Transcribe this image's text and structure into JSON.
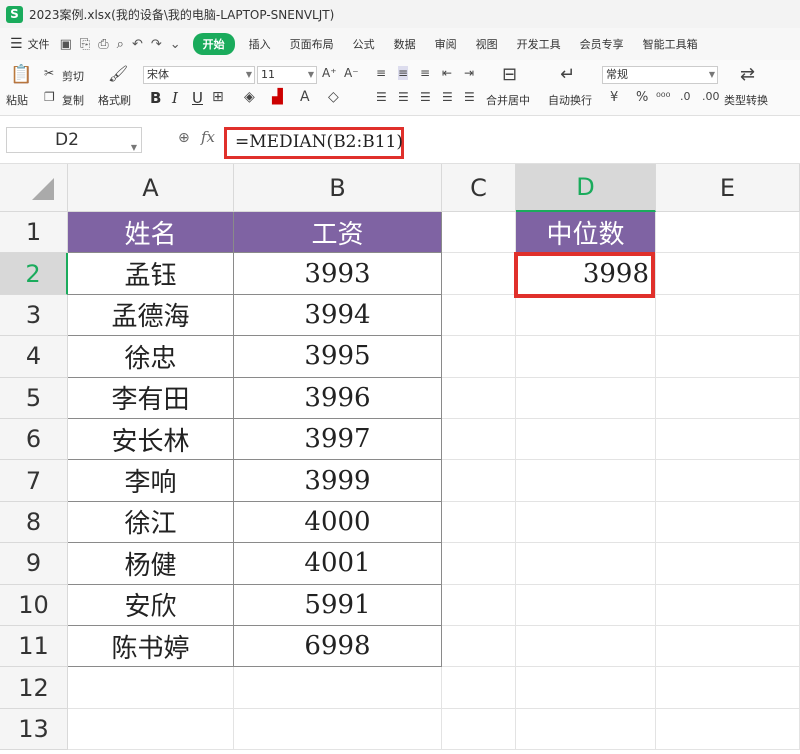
{
  "window": {
    "title": "2023案例.xlsx(我的设备\\我的电脑-LAPTOP-SNENVLJT)",
    "app_icon": "S"
  },
  "menubar": {
    "file": "文件",
    "tabs": [
      "开始",
      "插入",
      "页面布局",
      "公式",
      "数据",
      "审阅",
      "视图",
      "开发工具",
      "会员专享",
      "智能工具箱"
    ]
  },
  "ribbon": {
    "paste": "粘贴",
    "cut": "剪切",
    "copy": "复制",
    "format_painter": "格式刷",
    "font_name": "宋体",
    "font_size": "11",
    "bold": "B",
    "italic": "I",
    "underline": "U",
    "merge_center": "合并居中",
    "wrap_text": "自动换行",
    "number_format": "常规",
    "type_convert": "类型转换"
  },
  "formula_bar": {
    "name_box": "D2",
    "formula": "=MEDIAN(B2:B11)"
  },
  "columns": [
    "A",
    "B",
    "C",
    "D",
    "E"
  ],
  "rows": [
    "1",
    "2",
    "3",
    "4",
    "5",
    "6",
    "7",
    "8",
    "9",
    "10",
    "11",
    "12",
    "13"
  ],
  "table": {
    "headers": {
      "name": "姓名",
      "salary": "工资"
    },
    "data": [
      {
        "name": "孟钰",
        "salary": "3993"
      },
      {
        "name": "孟德海",
        "salary": "3994"
      },
      {
        "name": "徐忠",
        "salary": "3995"
      },
      {
        "name": "李有田",
        "salary": "3996"
      },
      {
        "name": "安长林",
        "salary": "3997"
      },
      {
        "name": "李响",
        "salary": "3999"
      },
      {
        "name": "徐江",
        "salary": "4000"
      },
      {
        "name": "杨健",
        "salary": "4001"
      },
      {
        "name": "安欣",
        "salary": "5991"
      },
      {
        "name": "陈书婷",
        "salary": "6998"
      }
    ]
  },
  "median": {
    "header": "中位数",
    "value": "3998"
  },
  "colors": {
    "header_fill": "#7f63a3",
    "accent": "#1aab5c",
    "highlight": "#e0302b"
  }
}
